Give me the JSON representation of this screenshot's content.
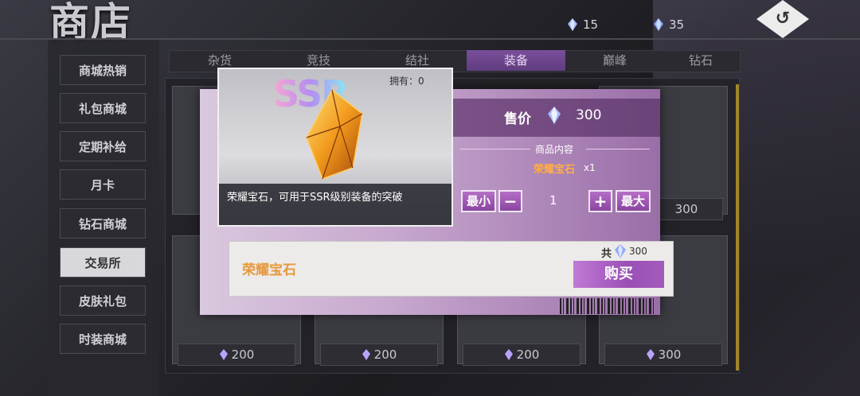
{
  "header": {
    "title": "商店",
    "currency_1": "15",
    "currency_2": "35",
    "back_icon": "↺"
  },
  "sidebar": {
    "items": [
      {
        "label": "商城热销"
      },
      {
        "label": "礼包商城"
      },
      {
        "label": "定期补给"
      },
      {
        "label": "月卡"
      },
      {
        "label": "钻石商城"
      },
      {
        "label": "交易所",
        "active": true
      },
      {
        "label": "皮肤礼包"
      },
      {
        "label": "时装商城"
      }
    ]
  },
  "tabs": [
    {
      "label": "杂货"
    },
    {
      "label": "竞技"
    },
    {
      "label": "结社"
    },
    {
      "label": "装备",
      "active": true
    },
    {
      "label": "巅峰"
    },
    {
      "label": "钻石"
    }
  ],
  "grid": {
    "prices": [
      "200",
      "200",
      "200",
      "300",
      "300"
    ]
  },
  "popup": {
    "rarity": "SSR",
    "owned": "拥有：0",
    "description": "荣耀宝石，可用于SSR级别装备的突破",
    "price_label": "售价",
    "price_value": "300",
    "contents_label": "商品内容",
    "content_name": "荣耀宝石",
    "content_qty": "x1",
    "min_label": "最小",
    "minus_label": "−",
    "quantity": "1",
    "plus_label": "+",
    "max_label": "最大",
    "item_name": "荣耀宝石",
    "total_label": "共",
    "total_value": "300",
    "buy_label": "购买"
  },
  "colors": {
    "accent_purple": "#8a45a0",
    "item_name_orange": "#e6983a"
  }
}
